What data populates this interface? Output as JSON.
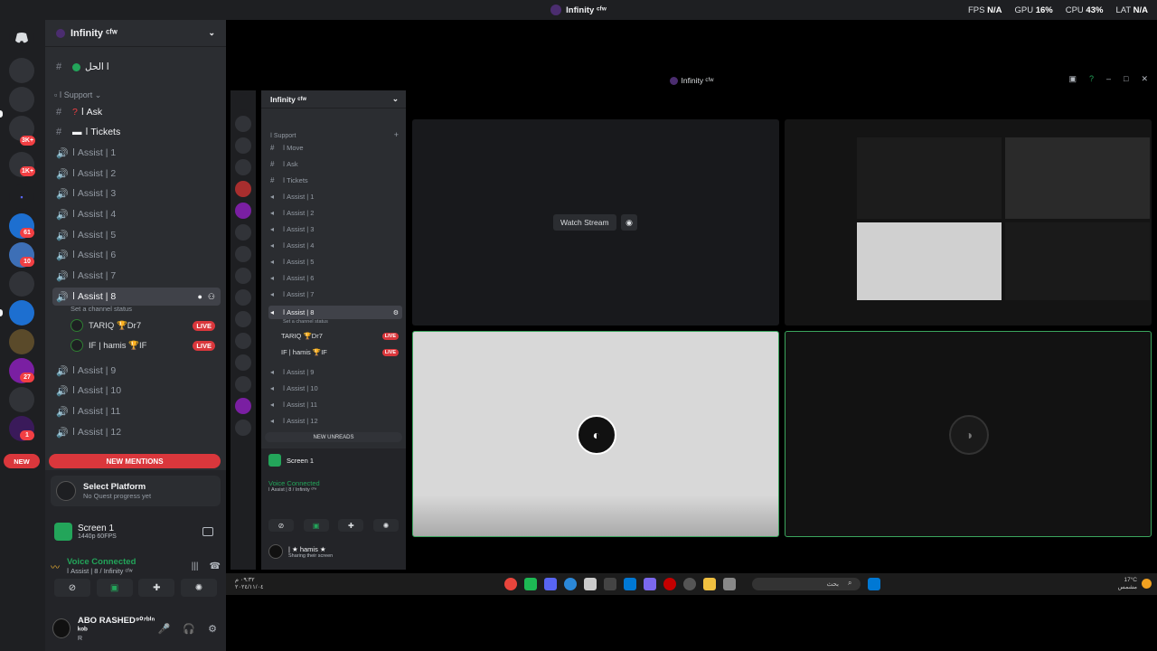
{
  "titlebar": {
    "title": "Infinity ᶜᶠʷ"
  },
  "stats": {
    "fps_label": "FPS",
    "fps": "N/A",
    "gpu_label": "GPU",
    "gpu": "16%",
    "cpu_label": "CPU",
    "cpu": "43%",
    "lat_label": "LAT",
    "lat": "N/A"
  },
  "rail": {
    "badges": [
      "3K+",
      "1K+",
      "61",
      "10",
      "27",
      "1"
    ],
    "new_label": "NEW"
  },
  "sidebar": {
    "server_name": "Infinity ᶜᶠʷ",
    "top_channel": "ا الحل",
    "category_support": "ا Support",
    "channels": {
      "ask": "ا Ask",
      "tickets": "ا Tickets",
      "assist1": "ا Assist | 1",
      "assist2": "ا Assist | 2",
      "assist3": "ا Assist | 3",
      "assist4": "ا Assist | 4",
      "assist5": "ا Assist | 5",
      "assist6": "ا Assist | 6",
      "assist7": "ا Assist | 7",
      "assist8": "ا Assist | 8",
      "assist8_status": "Set a channel status",
      "assist9": "ا Assist | 9",
      "assist10": "ا Assist | 10",
      "assist11": "ا Assist | 11",
      "assist12": "ا Assist | 12"
    },
    "voice_users": [
      {
        "name": "TARIQ 🏆Dr7",
        "live": "LIVE"
      },
      {
        "name": "IF | hamis 🏆IF",
        "live": "LIVE"
      }
    ],
    "new_mentions": "NEW MENTIONS"
  },
  "panel": {
    "quest_title": "Select Platform",
    "quest_sub": "No Quest progress yet",
    "screen_title": "Screen 1",
    "screen_sub": "1440p 60FPS",
    "voice_title": "Voice Connected",
    "voice_sub": "ا Assist | 8 / Infinity ᶜᶠʷ",
    "user_name": "ABO RASHED⁹⁰⁷ᵇⁱⁿ ᵏᵒᵇ",
    "user_sub": "R"
  },
  "embed": {
    "title": "Infinity ᶜᶠʷ",
    "server_name": "Infinity ᶜᶠʷ",
    "category": "ا Support",
    "channels": [
      "ا Move",
      "ا Ask",
      "ا Tickets",
      "ا Assist | 1",
      "ا Assist | 2",
      "ا Assist | 3",
      "ا Assist | 4",
      "ا Assist | 5",
      "ا Assist | 6",
      "ا Assist | 7"
    ],
    "active": "ا Assist | 8",
    "active_status": "Set a channel status",
    "users": [
      "TARIQ 🏆Dr7",
      "IF | hamis 🏆IF"
    ],
    "after": [
      "ا Assist | 9",
      "ا Assist | 10",
      "ا Assist | 11",
      "ا Assist | 12"
    ],
    "new_unreads": "NEW UNREADS",
    "screen_title": "Screen 1",
    "voice_title": "Voice Connected",
    "voice_sub": "ا Assist | 8 / Infinity ᶜᶠʷ",
    "user_name": "| ★ hamis ★",
    "user_sub": "Sharing their screen",
    "live": "LIVE"
  },
  "stream": {
    "watch_label": "Watch Stream"
  },
  "taskbar": {
    "clock_time": "٠٩:٣٢ م",
    "clock_date": "٢٠٢٤/١١/٠٤",
    "weather_temp": "17°C",
    "weather_desc": "مشمس",
    "search_placeholder": "بحث"
  }
}
